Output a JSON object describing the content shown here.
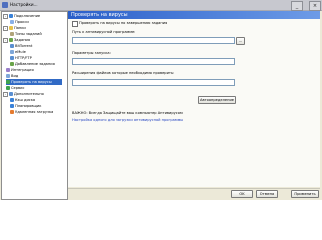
{
  "window": {
    "title": "Настройки..."
  },
  "tree": [
    {
      "label": "Подключение",
      "icon": "globe-icon"
    },
    {
      "label": "Прокси",
      "icon": "proxy-icon"
    },
    {
      "label": "Папки",
      "icon": "folder-icon"
    },
    {
      "label": "Типы заданий",
      "icon": "list-icon"
    },
    {
      "label": "Задания",
      "icon": "task-icon"
    },
    {
      "label": "BitTorrent",
      "icon": "torrent-icon"
    },
    {
      "label": "eMule",
      "icon": "emule-icon"
    },
    {
      "label": "HTTP/FTP",
      "icon": "http-icon"
    },
    {
      "label": "Добавление задания",
      "icon": "add-task-icon"
    },
    {
      "label": "Интеграция",
      "icon": "integration-icon"
    },
    {
      "label": "Вид",
      "icon": "view-icon"
    },
    {
      "label": "Проверять на вирусы",
      "icon": "virus-check-icon"
    },
    {
      "label": "Сервис",
      "icon": "service-icon"
    },
    {
      "label": "Дополнительно",
      "icon": "more-icon"
    },
    {
      "label": "Кэш диска",
      "icon": "disk-cache-icon"
    },
    {
      "label": "Планировщик",
      "icon": "scheduler-icon"
    },
    {
      "label": "Удаленная загрузка",
      "icon": "remote-download-icon"
    }
  ],
  "panel": {
    "header": "Проверять на вирусы",
    "check_label": "Проверять на вирусы по завершению задания",
    "path_label": "Путь к антивирусной программе:",
    "path_value": "",
    "browse_label": "...",
    "params_label": "Параметры запуска:",
    "params_value": "",
    "ext_label": "Расширения файлов которые необходимо проверить:",
    "ext_value": "",
    "detect_button": "Автоопределение",
    "warning": "ВАЖНО: Всегда Защищайте ваш компьютер Антивирусом",
    "link": "Настройка одного для загрузки антивирусной программы"
  },
  "footer": {
    "ok": "OK",
    "cancel": "Отмена",
    "apply": "Применить"
  }
}
